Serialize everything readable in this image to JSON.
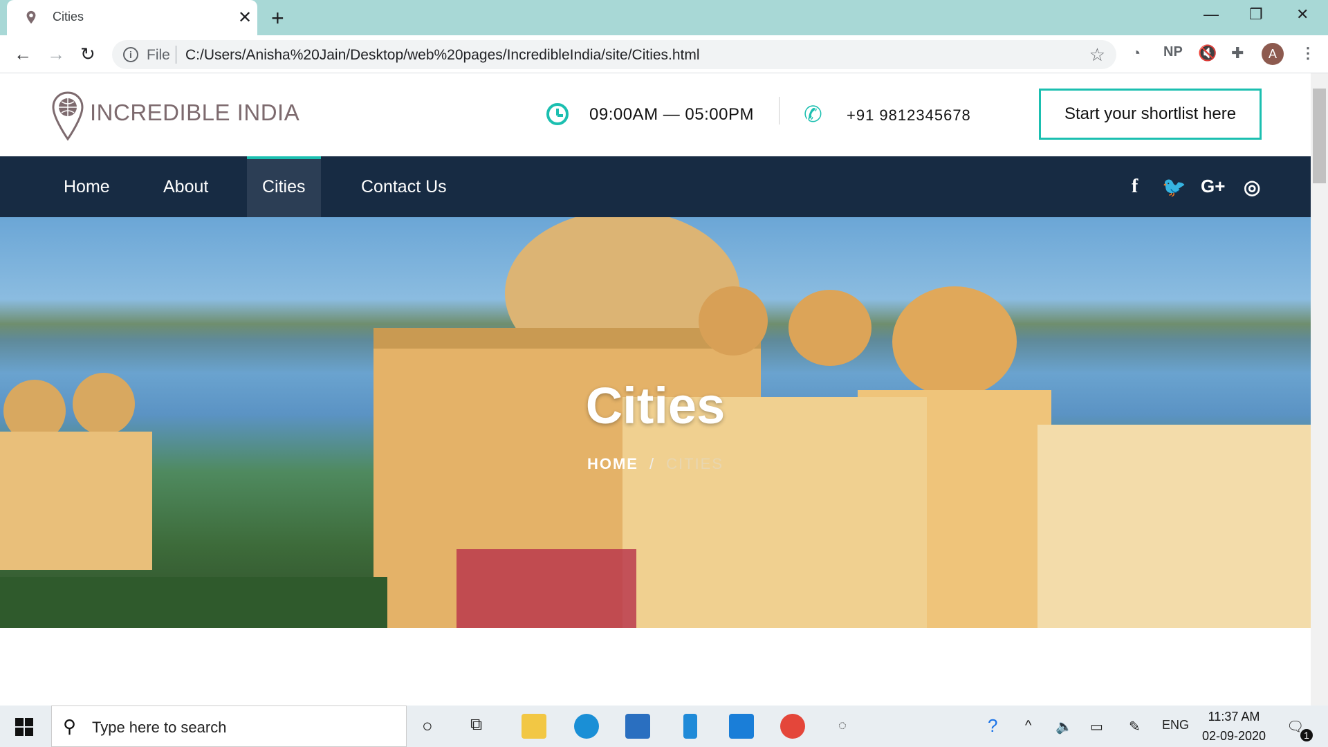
{
  "browser": {
    "tab_title": "Cities",
    "url_scheme_label": "File",
    "url": "C:/Users/Anisha%20Jain/Desktop/web%20pages/IncredibleIndia/site/Cities.html",
    "profile_initial": "A",
    "extension_np": "NP"
  },
  "site": {
    "logo_text": "INCREDIBLE INDIA",
    "hours": "09:00AM — 05:00PM",
    "phone": "+91 9812345678",
    "cta": "Start your shortlist here",
    "nav": [
      {
        "label": "Home"
      },
      {
        "label": "About"
      },
      {
        "label": "Cities"
      },
      {
        "label": "Contact Us"
      }
    ],
    "social": [
      "f",
      "t",
      "G+",
      "ig"
    ],
    "accent": "#1bbfb0",
    "nav_bg": "#172b43"
  },
  "hero": {
    "title": "Cities",
    "breadcrumb_home": "HOME",
    "breadcrumb_sep": "/",
    "breadcrumb_current": "CITIES"
  },
  "taskbar": {
    "search_placeholder": "Type here to search",
    "lang": "ENG",
    "time": "11:37 AM",
    "date": "02-09-2020",
    "notification_count": "1"
  }
}
